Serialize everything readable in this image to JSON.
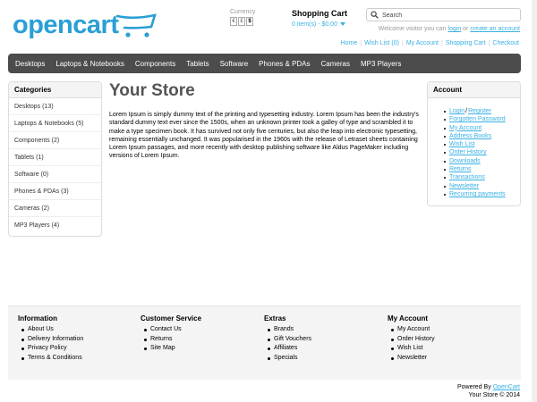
{
  "header": {
    "logo_text": "opencart",
    "currency": {
      "label": "Currency",
      "options": [
        "€",
        "£",
        "$"
      ],
      "selected": "$"
    },
    "cart": {
      "title": "Shopping Cart",
      "items": "0 item(s) - $0.00"
    },
    "search": {
      "placeholder": "Search"
    },
    "welcome": {
      "prefix": "Welcome visitor you can ",
      "login": "login",
      "or": " or ",
      "create": "create an account"
    },
    "links": [
      "Home",
      "Wish List (0)",
      "My Account",
      "Shopping Cart",
      "Checkout"
    ]
  },
  "nav": [
    "Desktops",
    "Laptops & Notebooks",
    "Components",
    "Tablets",
    "Software",
    "Phones & PDAs",
    "Cameras",
    "MP3 Players"
  ],
  "categories": {
    "title": "Categories",
    "items": [
      "Desktops (13)",
      "Laptops & Notebooks (5)",
      "Components (2)",
      "Tablets (1)",
      "Software (0)",
      "Phones & PDAs (3)",
      "Cameras (2)",
      "MP3 Players (4)"
    ]
  },
  "main": {
    "title": "Your Store",
    "text": "Lorem Ipsum is simply dummy text of the printing and typesetting industry. Lorem Ipsum has been the industry's standard dummy text ever since the 1500s, when an unknown printer took a galley of type and scrambled it to make a type specimen book. It has survived not only five centuries, but also the leap into electronic typesetting, remaining essentially unchanged. It was popularised in the 1960s with the release of Letraset sheets containing Lorem Ipsum passages, and more recently with desktop publishing software like Aldus PageMaker including versions of Lorem Ipsum."
  },
  "account": {
    "title": "Account",
    "login": "Login",
    "slash": "/",
    "register": "Register",
    "items": [
      "Forgotten Password",
      "My Account",
      "Address Books",
      "Wish List",
      "Order History",
      "Downloads",
      "Returns",
      "Transactions",
      "Newsletter",
      "Recurring payments"
    ]
  },
  "footer": {
    "columns": [
      {
        "title": "Information",
        "items": [
          "About Us",
          "Delivery Information",
          "Privacy Policy",
          "Terms & Conditions"
        ]
      },
      {
        "title": "Customer Service",
        "items": [
          "Contact Us",
          "Returns",
          "Site Map"
        ]
      },
      {
        "title": "Extras",
        "items": [
          "Brands",
          "Gift Vouchers",
          "Affiliates",
          "Specials"
        ]
      },
      {
        "title": "My Account",
        "items": [
          "My Account",
          "Order History",
          "Wish List",
          "Newsletter"
        ]
      }
    ],
    "powered_prefix": "Powered By ",
    "powered_link": "OpenCart",
    "copyright": "Your Store © 2014"
  },
  "colors": {
    "link": "#38b0e3",
    "logo": "#2a9fd6",
    "nav_bg": "#4c4c4c",
    "box_head_bg": "#f4f4f4"
  }
}
